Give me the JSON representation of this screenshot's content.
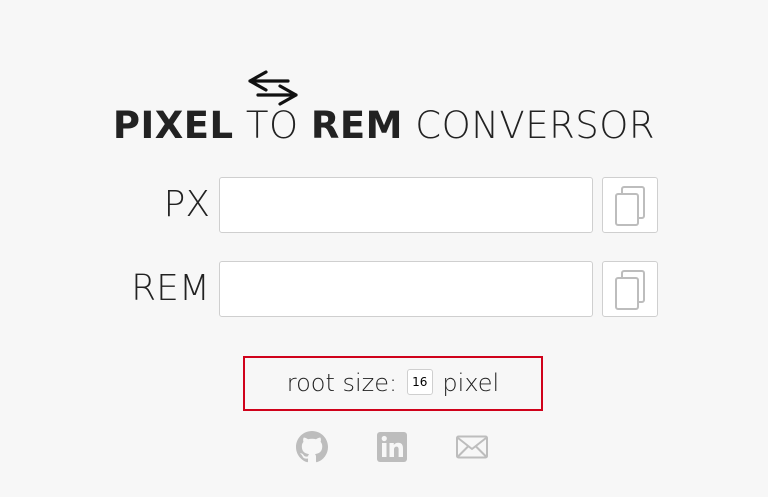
{
  "title": {
    "part1": "PIXEL",
    "part2": " TO ",
    "part3": "REM",
    "part4": " CONVERSOR"
  },
  "rows": [
    {
      "label": "PX",
      "value": "",
      "copy_icon": "copy-icon"
    },
    {
      "label": "REM",
      "value": "",
      "copy_icon": "copy-icon"
    }
  ],
  "root_size": {
    "prefix": "root size:",
    "value": "16",
    "suffix": "pixel"
  },
  "icons": {
    "swap": "swap-arrows-icon",
    "social": [
      "github-icon",
      "linkedin-icon",
      "mail-icon"
    ]
  },
  "colors": {
    "background": "#f7f7f7",
    "text": "#222222",
    "highlight_border": "#d0021b",
    "muted_icon": "#bdbdbd"
  }
}
